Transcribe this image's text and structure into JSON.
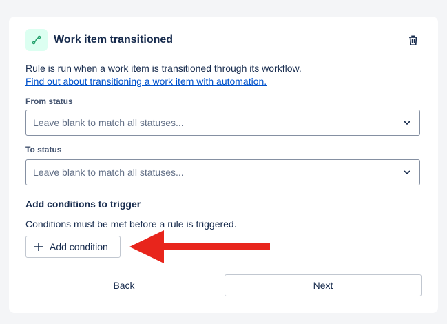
{
  "header": {
    "title": "Work item transitioned",
    "trigger_icon": "workflow-transition-icon",
    "delete_icon": "trash-icon",
    "icon_color": "#22a06b",
    "icon_bg": "#dcfff1"
  },
  "description": {
    "text": "Rule is run when a work item is transitioned through its workflow.",
    "link": "Find out about transitioning a work item with automation."
  },
  "from_status": {
    "label": "From status",
    "placeholder": "Leave blank to match all statuses..."
  },
  "to_status": {
    "label": "To status",
    "placeholder": "Leave blank to match all statuses..."
  },
  "conditions": {
    "heading": "Add conditions to trigger",
    "description": "Conditions must be met before a rule is triggered.",
    "add_button": "Add condition"
  },
  "footer": {
    "back_label": "Back",
    "next_label": "Next"
  },
  "annotation": {
    "arrow_color": "#e8251c"
  }
}
